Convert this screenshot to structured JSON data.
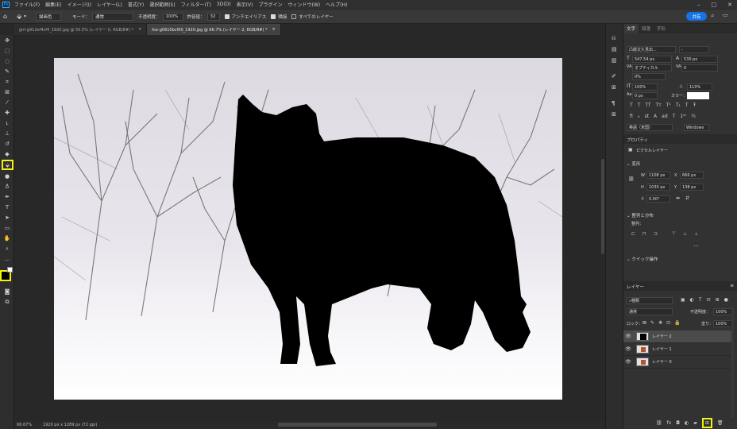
{
  "menu": [
    "ファイル(F)",
    "編集(E)",
    "イメージ(I)",
    "レイヤー(L)",
    "書式(Y)",
    "選択範囲(S)",
    "フィルター(T)",
    "3D(D)",
    "表示(V)",
    "プラグイン",
    "ウィンドウ(W)",
    "ヘルプ(H)"
  ],
  "options": {
    "fill_source": "描画色",
    "mode_label": "モード：",
    "mode_value": "通常",
    "opacity_label": "不透明度：",
    "opacity_value": "100%",
    "tolerance_label": "許容値：",
    "tolerance_value": "32",
    "antialias_label": "アンチエイリアス",
    "contiguous_label": "隣接",
    "all_layers_label": "すべてのレイヤー",
    "share_label": "共有"
  },
  "tabs": [
    {
      "label": "girl-g912ef4cf4_1920.jpg @ 50.5% (レイヤー 0, RGB/8#) *",
      "active": false
    },
    {
      "label": "fox-g0610bcf00_1920.jpg @ 66.7% (レイヤー 2, RGB/8#) *",
      "active": true
    }
  ],
  "status": {
    "zoom": "66.67%",
    "doc_size": "1920 px x 1289 px (72 ppi)"
  },
  "char_panel": {
    "tabs": [
      "文字",
      "段落",
      "字形"
    ],
    "font_family": "凸版文久見出...",
    "font_style": "-",
    "font_size": "547.54 px",
    "leading": "530 px",
    "kerning": "オプティカル",
    "tracking": "0",
    "tsume": "0%",
    "vscale": "100%",
    "hscale": "110%",
    "baseline": "0 px",
    "color_label": "カラー：",
    "language": "英語（米国）",
    "aa_method": "Windows"
  },
  "props_panel": {
    "title": "プロパティ",
    "kind": "ピクセルレイヤー",
    "transform_title": "変形",
    "w_label": "W",
    "w_value": "1108 px",
    "x_label": "X",
    "x_value": "666 px",
    "h_label": "H",
    "h_value": "1030 px",
    "y_label": "Y",
    "y_value": "138 px",
    "angle_value": "0.00°",
    "align_title": "整列と分布",
    "align_label": "整列：",
    "quick_title": "クイック操作"
  },
  "layers_panel": {
    "title": "レイヤー",
    "filter_kind": "種類",
    "blend_mode": "通常",
    "opacity_label": "不透明度：",
    "opacity_value": "100%",
    "lock_label": "ロック：",
    "fill_label": "塗り：",
    "fill_value": "100%",
    "layers": [
      {
        "name": "レイヤー 2",
        "selected": true
      },
      {
        "name": "レイヤー 1",
        "selected": false
      },
      {
        "name": "レイヤー 0",
        "selected": false
      }
    ]
  },
  "colors": {
    "accent": "#31a8ff",
    "highlight": "#f2f20c",
    "share": "#1473e6"
  }
}
